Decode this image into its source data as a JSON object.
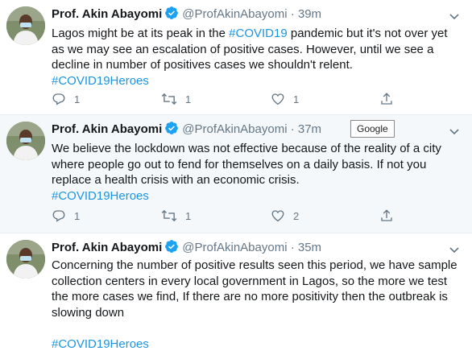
{
  "tweets": [
    {
      "author_name": "Prof. Akin Abayomi",
      "handle": "@ProfAkinAbayomi",
      "separator": "·",
      "time": "39m",
      "text_before": "Lagos might be at its peak in the ",
      "inline_hashtag": "#COVID19",
      "text_after": " pandemic but it's not over yet as we may see an escalation of positive cases. However, until we see a decline in number of positives cases we shouldn't relent.",
      "hashtag": "#COVID19Heroes",
      "reply_count": "1",
      "retweet_count": "1",
      "like_count": "1"
    },
    {
      "author_name": "Prof. Akin Abayomi",
      "handle": "@ProfAkinAbayomi",
      "separator": "·",
      "time": "37m",
      "text": "We believe the lockdown was not effective because of the reality of a city where people go out to fend for themselves on a daily basis. If not you replace a health crisis with an economic crisis.",
      "hashtag": "#COVID19Heroes",
      "reply_count": "1",
      "retweet_count": "1",
      "like_count": "2",
      "badge": "Google"
    },
    {
      "author_name": "Prof. Akin Abayomi",
      "handle": "@ProfAkinAbayomi",
      "separator": "·",
      "time": "35m",
      "text": "Concerning the number of positive results seen this period, we have sample collection centers in every local government in Lagos, so the more we test the more cases we find, If there are no more positivity then the outbreak is slowing down",
      "hashtag": "#COVID19Heroes"
    }
  ],
  "icons": {
    "reply": "reply-icon",
    "retweet": "retweet-icon",
    "like": "like-icon",
    "share": "share-icon",
    "verified": "verified-badge-icon",
    "caret": "chevron-down-icon"
  },
  "colors": {
    "link": "#1b95e0",
    "verified": "#1da1f2",
    "muted": "#657786",
    "selected_row": "#f5f8fa"
  }
}
